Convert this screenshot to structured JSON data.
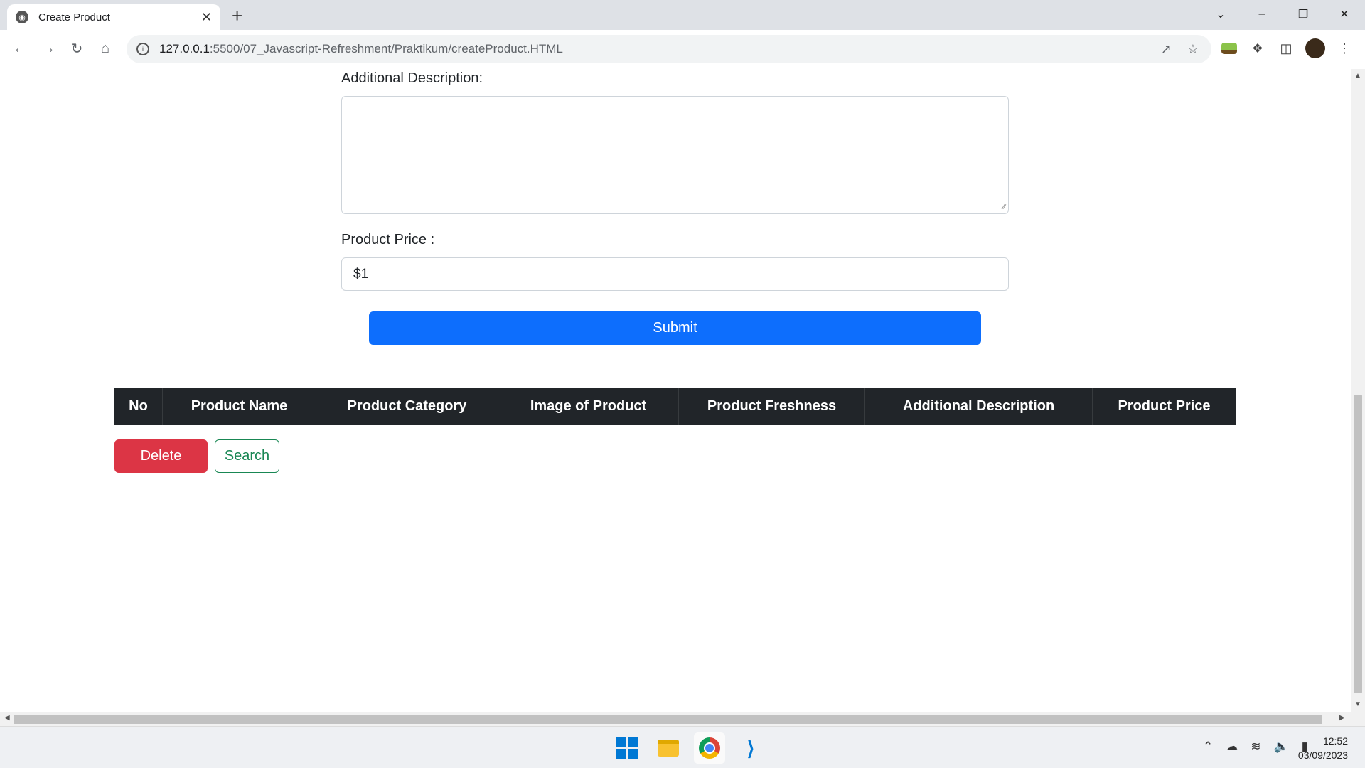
{
  "browser": {
    "tab_title": "Create Product",
    "url_host": "127.0.0.1",
    "url_path": ":5500/07_Javascript-Refreshment/Praktikum/createProduct.HTML"
  },
  "form": {
    "description_label": "Additional Description:",
    "price_label": "Product Price :",
    "price_value": "$1",
    "submit_label": "Submit"
  },
  "table": {
    "headers": [
      "No",
      "Product Name",
      "Product Category",
      "Image of Product",
      "Product Freshness",
      "Additional Description",
      "Product Price"
    ]
  },
  "actions": {
    "delete_label": "Delete",
    "search_label": "Search"
  },
  "taskbar": {
    "time": "12:52",
    "date": "03/09/2023"
  },
  "colors": {
    "primary": "#0d6efd",
    "danger": "#dc3545",
    "success": "#198754",
    "table_header": "#212529"
  }
}
